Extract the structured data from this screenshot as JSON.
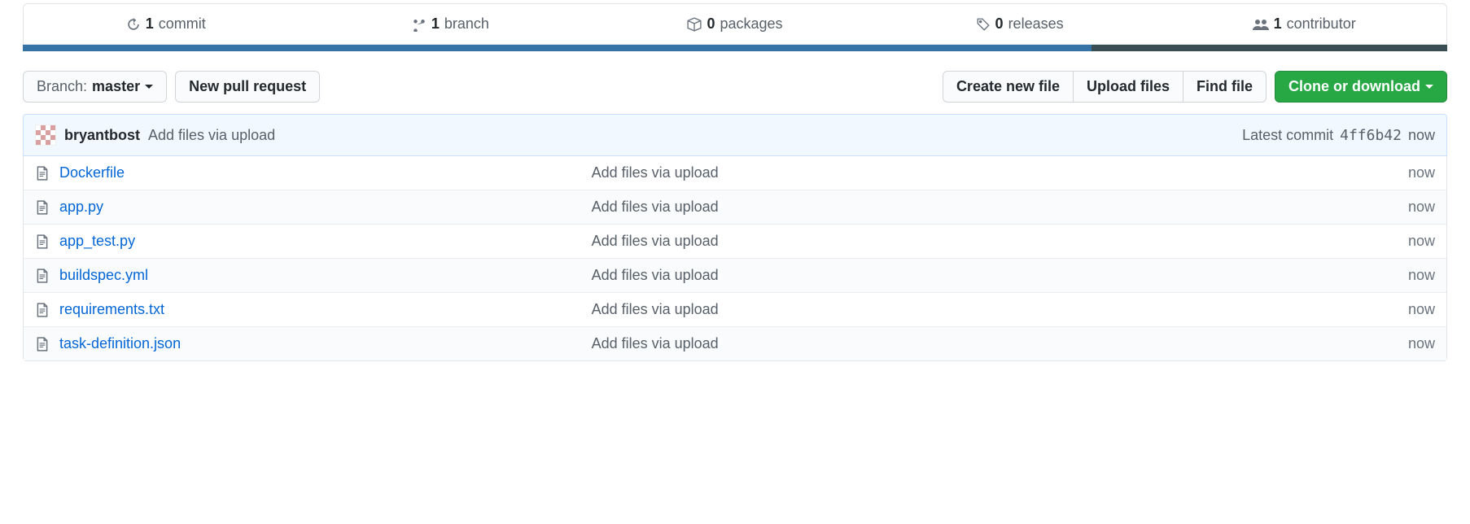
{
  "stats": {
    "commits": {
      "count": "1",
      "label": "commit"
    },
    "branches": {
      "count": "1",
      "label": "branch"
    },
    "packages": {
      "count": "0",
      "label": "packages"
    },
    "releases": {
      "count": "0",
      "label": "releases"
    },
    "contributors": {
      "count": "1",
      "label": "contributor"
    }
  },
  "toolbar": {
    "branch_prefix": "Branch:",
    "branch_name": "master",
    "new_pr": "New pull request",
    "create_file": "Create new file",
    "upload_files": "Upload files",
    "find_file": "Find file",
    "clone": "Clone or download"
  },
  "commit_bar": {
    "author": "bryantbost",
    "message": "Add files via upload",
    "latest_label": "Latest commit",
    "sha": "4ff6b42",
    "time": "now"
  },
  "files": [
    {
      "name": "Dockerfile",
      "msg": "Add files via upload",
      "time": "now"
    },
    {
      "name": "app.py",
      "msg": "Add files via upload",
      "time": "now"
    },
    {
      "name": "app_test.py",
      "msg": "Add files via upload",
      "time": "now"
    },
    {
      "name": "buildspec.yml",
      "msg": "Add files via upload",
      "time": "now"
    },
    {
      "name": "requirements.txt",
      "msg": "Add files via upload",
      "time": "now"
    },
    {
      "name": "task-definition.json",
      "msg": "Add files via upload",
      "time": "now"
    }
  ]
}
